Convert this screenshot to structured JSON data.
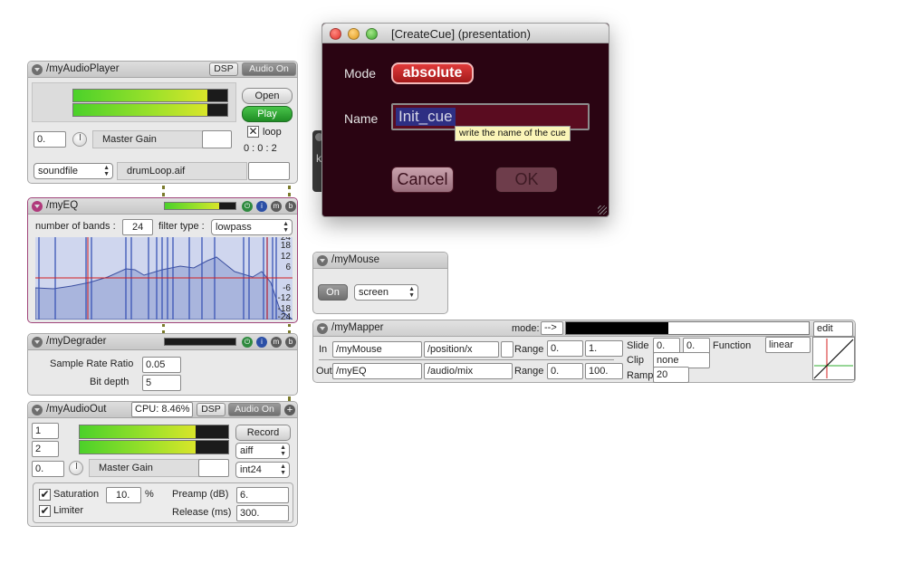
{
  "audio_player": {
    "title": "/myAudioPlayer",
    "dsp": "DSP",
    "audio_on": "Audio On",
    "open": "Open",
    "play": "Play",
    "loop": "loop",
    "time": "0 : 0 : 2",
    "gain_value": "0.",
    "gain_label": "Master Gain",
    "source": "soundfile",
    "file": "drumLoop.aif"
  },
  "eq": {
    "title": "/myEQ",
    "bands_label": "number of bands :",
    "bands_value": "24",
    "filter_label": "filter type :",
    "filter_value": "lowpass",
    "db_ticks": [
      "24",
      "18",
      "12",
      "6",
      "-6",
      "-12",
      "-18",
      "-24"
    ],
    "btn_m": "m",
    "btn_b": "b"
  },
  "degrader": {
    "title": "/myDegrader",
    "srr_label": "Sample Rate Ratio",
    "srr_value": "0.05",
    "bit_label": "Bit depth",
    "bit_value": "5",
    "btn_m": "m",
    "btn_b": "b"
  },
  "audio_out": {
    "title": "/myAudioOut",
    "cpu": "CPU: 8.46%",
    "dsp": "DSP",
    "audio_on": "Audio On",
    "plus": "+",
    "ch1": "1",
    "ch2": "2",
    "record": "Record",
    "format": "aiff",
    "depth": "int24",
    "gain_value": "0.",
    "gain_label": "Master Gain",
    "saturation_label": "Saturation",
    "saturation_value": "10.",
    "percent": "%",
    "preamp_label": "Preamp (dB)",
    "preamp_value": "6.",
    "limiter_label": "Limiter",
    "release_label": "Release (ms)",
    "release_value": "300."
  },
  "dialog": {
    "title": "[CreateCue] (presentation)",
    "mode_label": "Mode",
    "mode_value": "absolute",
    "name_label": "Name",
    "name_value": "Init_cue",
    "tooltip": "write the name of the cue",
    "cancel": "Cancel",
    "ok": "OK"
  },
  "hidden_module": {
    "letter": "k"
  },
  "mouse": {
    "title": "/myMouse",
    "on": "On",
    "source": "screen"
  },
  "mapper": {
    "title": "/myMapper",
    "mode_label": "mode:",
    "mode_value": "-->",
    "edit": "edit",
    "in_label": "In",
    "in_address": "/myMouse",
    "in_param": "/position/x",
    "out_label": "Out",
    "out_address": "/myEQ",
    "out_param": "/audio/mix",
    "range_label": "Range",
    "in_range_min": "0.",
    "in_range_max": "1.",
    "out_range_min": "0.",
    "out_range_max": "100.",
    "slide_label": "Slide",
    "slide_a": "0.",
    "slide_b": "0.",
    "clip_label": "Clip",
    "clip_value": "none",
    "ramp_label": "Ramp",
    "ramp_value": "20",
    "function_label": "Function",
    "function_value": "linear",
    "progress": 0.42
  },
  "colors": {
    "dialog_bg": "#2a0412",
    "mode_button": "#c62828",
    "play_green": "#2fa833",
    "eq_border": "#a0457a",
    "meter_green": "#5fd12a"
  }
}
